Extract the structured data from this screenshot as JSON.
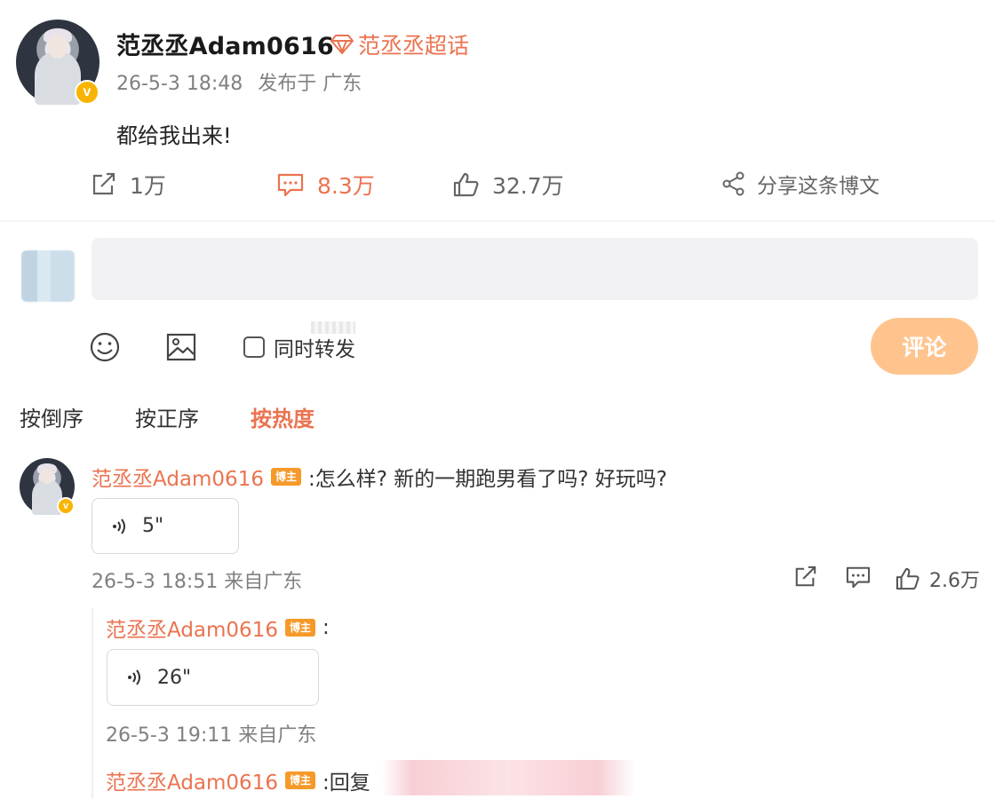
{
  "post": {
    "username": "范丞丞Adam0616",
    "supertopic_label": "范丞丞超话",
    "time": "26-5-3 18:48",
    "location": "发布于 广东",
    "content": "都给我出来!",
    "stats": {
      "repost": "1万",
      "comment": "8.3万",
      "like": "32.7万",
      "share_label": "分享这条博文"
    }
  },
  "composer": {
    "placeholder": "",
    "also_repost_label": "同时转发",
    "submit_label": "评论"
  },
  "sort_tabs": [
    "按倒序",
    "按正序",
    "按热度"
  ],
  "host_badge": "博主",
  "comments": [
    {
      "username": "范丞丞Adam0616",
      "text": ":怎么样? 新的一期跑男看了吗? 好玩吗?",
      "voice_duration": "5\"",
      "meta": "26-5-3 18:51 来自广东",
      "likes": "2.6万",
      "replies": [
        {
          "username": "范丞丞Adam0616",
          "text": ":",
          "voice_duration": "26\"",
          "meta": "26-5-3 19:11 来自广东"
        },
        {
          "username": "范丞丞Adam0616",
          "text": ":回复"
        }
      ]
    }
  ],
  "colors": {
    "accent": "#eb7350",
    "host_badge": "#f59a2a",
    "submit_button": "#ffc48e",
    "verified_badge": "#f8b400",
    "input_bg": "#f2f2f5"
  },
  "icons": [
    "repost-icon",
    "comment-icon",
    "like-icon",
    "share-icon",
    "emoji-icon",
    "image-icon",
    "voice-icon",
    "diamond-icon",
    "verified-icon"
  ]
}
